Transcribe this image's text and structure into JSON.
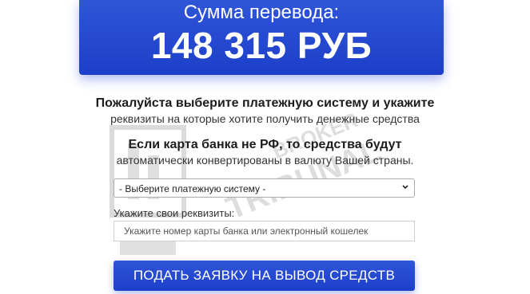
{
  "amount": {
    "label": "Сумма перевода:",
    "value": "148 315 РУБ"
  },
  "instruction_primary": {
    "title": "Пожалуйста выберите платежную систему и укажите",
    "subtitle": "реквизиты на которые хотите получить денежные средства"
  },
  "instruction_secondary": {
    "title": "Если карта банка не РФ, то средства будут",
    "subtitle": "автоматически конвертированы в валюту Вашей страны."
  },
  "payment_system_select": {
    "selected": "- Выберите платежную систему -"
  },
  "requisites": {
    "label": "Укажите свои реквизиты:",
    "placeholder": "Укажите номер карты банка или электронный кошелек"
  },
  "submit_button": {
    "label": "ПОДАТЬ ЗАЯВКУ НА ВЫВОД СРЕДСТВ"
  },
  "watermark": {
    "line1": "BROKER",
    "line2": "TRIBUNAL"
  },
  "colors": {
    "primary_blue": "#2246d1",
    "text_dark": "#1c1c1c",
    "border_gray": "#aaaaaa"
  }
}
